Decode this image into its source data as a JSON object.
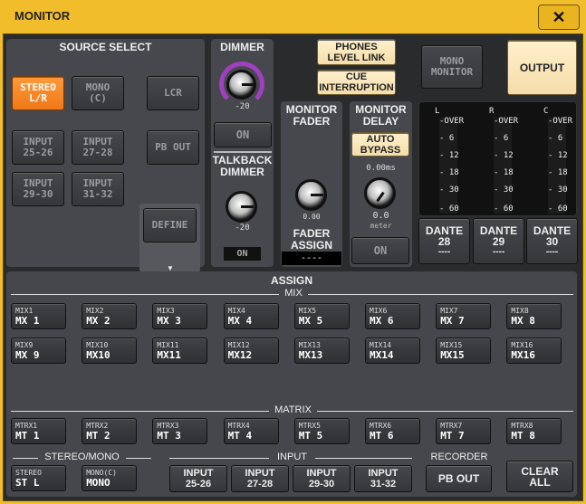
{
  "window": {
    "title": "MONITOR",
    "close_icon": "close-icon"
  },
  "source_select": {
    "title": "SOURCE SELECT",
    "stereo": [
      "STEREO",
      "L/R"
    ],
    "mono": [
      "MONO",
      "(C)"
    ],
    "lcr": "LCR",
    "pb_out": "PB OUT",
    "inputs": [
      [
        "INPUT",
        "25-26"
      ],
      [
        "INPUT",
        "27-28"
      ],
      [
        "INPUT",
        "29-30"
      ],
      [
        "INPUT",
        "31-32"
      ]
    ],
    "define": "DEFINE",
    "selected": "STEREO L/R"
  },
  "dimmer": {
    "title": "DIMMER",
    "value": "-20",
    "on": "ON",
    "talkback_title": [
      "TALKBACK",
      "DIMMER"
    ],
    "talkback_value": "-20",
    "talkback_on": "ON"
  },
  "phones_level_link": [
    "PHONES",
    "LEVEL LINK"
  ],
  "cue_interruption": [
    "CUE",
    "INTERRUPTION"
  ],
  "mono_monitor": [
    "MONO",
    "MONITOR"
  ],
  "output": "OUTPUT",
  "monitor_fader": {
    "title": [
      "MONITOR",
      "FADER"
    ],
    "value": "0.00",
    "assign_title": [
      "FADER",
      "ASSIGN"
    ],
    "assign_value": "----"
  },
  "monitor_delay": {
    "title": [
      "MONITOR",
      "DELAY"
    ],
    "auto_bypass": [
      "AUTO",
      "BYPASS"
    ],
    "time": "0.00ms",
    "value": "0.0",
    "unit": "meter",
    "on": "ON"
  },
  "meters": {
    "channels": [
      "L",
      "R",
      "C"
    ],
    "scale": [
      "-OVER",
      "- 6",
      "- 12",
      "- 18",
      "- 30",
      "- 60"
    ]
  },
  "dante": [
    [
      "DANTE",
      "28",
      "----"
    ],
    [
      "DANTE",
      "29",
      "----"
    ],
    [
      "DANTE",
      "30",
      "----"
    ]
  ],
  "assign": {
    "title": "ASSIGN",
    "mix_label": "MIX",
    "matrix_label": "MATRIX",
    "mix": [
      [
        "MIX1",
        "MX 1"
      ],
      [
        "MIX2",
        "MX 2"
      ],
      [
        "MIX3",
        "MX 3"
      ],
      [
        "MIX4",
        "MX 4"
      ],
      [
        "MIX5",
        "MX 5"
      ],
      [
        "MIX6",
        "MX 6"
      ],
      [
        "MIX7",
        "MX 7"
      ],
      [
        "MIX8",
        "MX 8"
      ],
      [
        "MIX9",
        "MX 9"
      ],
      [
        "MIX10",
        "MX10"
      ],
      [
        "MIX11",
        "MX11"
      ],
      [
        "MIX12",
        "MX12"
      ],
      [
        "MIX13",
        "MX13"
      ],
      [
        "MIX14",
        "MX14"
      ],
      [
        "MIX15",
        "MX15"
      ],
      [
        "MIX16",
        "MX16"
      ]
    ],
    "matrix": [
      [
        "MTRX1",
        "MT 1"
      ],
      [
        "MTRX2",
        "MT 2"
      ],
      [
        "MTRX3",
        "MT 3"
      ],
      [
        "MTRX4",
        "MT 4"
      ],
      [
        "MTRX5",
        "MT 5"
      ],
      [
        "MTRX6",
        "MT 6"
      ],
      [
        "MTRX7",
        "MT 7"
      ],
      [
        "MTRX8",
        "MT 8"
      ]
    ],
    "stereo_mono_label": "STEREO/MONO",
    "stereo_mono": [
      [
        "STEREO",
        "ST L"
      ],
      [
        "MONO(C)",
        "MONO"
      ]
    ],
    "input_label": "INPUT",
    "inputs": [
      [
        "INPUT",
        "25-26"
      ],
      [
        "INPUT",
        "27-28"
      ],
      [
        "INPUT",
        "29-30"
      ],
      [
        "INPUT",
        "31-32"
      ]
    ],
    "recorder_label": "RECORDER",
    "pb_out": "PB OUT",
    "clear_all": [
      "CLEAR",
      "ALL"
    ]
  },
  "colors": {
    "title_bar": "#f2bd2a",
    "selected": "#f07818",
    "active_cream": "#f5ddaa",
    "dimmer_ring": "#a040c0"
  }
}
